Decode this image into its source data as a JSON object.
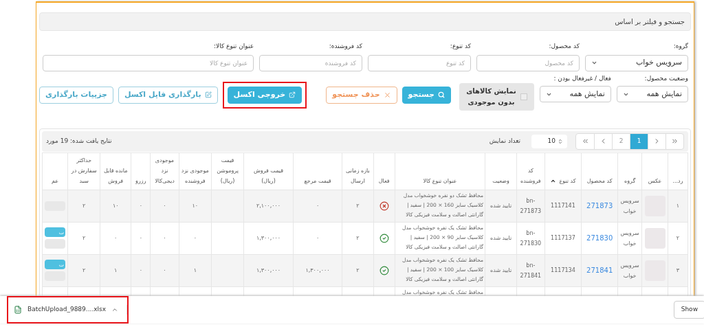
{
  "filter_panel": {
    "title": "جستجو و فیلتر بر اساس",
    "fields": [
      {
        "label": "گروه:",
        "kind": "select",
        "value": "سرویس خواب"
      },
      {
        "label": "کد محصول:",
        "kind": "input",
        "placeholder": "کد محصول"
      },
      {
        "label": "کد تنوع:",
        "kind": "input",
        "placeholder": "کد تنوع"
      },
      {
        "label": "کد فروشنده:",
        "kind": "input",
        "placeholder": "کد فروشنده"
      },
      {
        "label": "عنوان تنوع کالا:",
        "kind": "input",
        "placeholder": "عنوان تنوع کالا"
      }
    ],
    "filters": [
      {
        "label": "وضعیت محصول:",
        "kind": "select",
        "value": "نمایش همه"
      },
      {
        "label": "فعال / غیرفعال بودن :",
        "kind": "select",
        "value": "نمایش همه"
      }
    ],
    "checkbox": {
      "label": "نمایش کالاهای بدون موجودی",
      "checked": false
    },
    "buttons": [
      {
        "label": "جستجو",
        "kind": "search",
        "highlighted": false
      },
      {
        "label": "حذف جستجو",
        "kind": "clear",
        "highlighted": false
      },
      {
        "label": "خروجی اکسل",
        "kind": "export",
        "highlighted": true
      },
      {
        "label": "بارگذاری فایل اکسل",
        "kind": "upload",
        "highlighted": false
      },
      {
        "label": "جزییات بارگذاری",
        "kind": "details",
        "highlighted": false
      }
    ]
  },
  "table": {
    "pages": [
      {
        "label": "1",
        "selected": true
      },
      {
        "label": "2",
        "selected": false
      }
    ],
    "page_size": "10",
    "page_size_label": "تعداد نمایش",
    "results": "نتایج یافت شده: 19 مورد",
    "columns": [
      "رد...",
      "عکس",
      "گروه",
      "کد محصول",
      "کد تنوع",
      "کد فروشنده",
      "وضعیت",
      "عنوان تنوع کالا",
      "فعال",
      "بازه زمانی ارسال",
      "قیمت مرجع",
      "قیمت فروش (ریال)",
      "قیمت پروموشن (ریال)",
      "موجودی نزد فروشنده",
      "موجودی نزد دیجی‌کالا",
      "رزرو",
      "مانده قابل فروش",
      "حداکثر سفارش در سبد",
      "عم"
    ],
    "rows": [
      {
        "row": "۱",
        "photo": true,
        "group": "سرویس خواب",
        "product_code": "271873",
        "variant_code": "1117141",
        "seller_code": "bn-271873",
        "status": "تایید شده",
        "title": "محافظ تشک دو نفره خوشخواب مدل کلاسیک سایز 160 × 200 | سفید | گارانتی اصالت و سلامت فیزیکی کالا",
        "active": false,
        "send_period": "۲",
        "ref_price": "۰",
        "sale_price": "۲,۱۰۰,۰۰۰",
        "seller_stock": "۱۰",
        "dk_stock": "۰",
        "reserved": "۰",
        "remaining": "۱۰",
        "max_order": "۲",
        "actions": [
          {
            "kind": "secondary"
          }
        ]
      },
      {
        "row": "۲",
        "photo": true,
        "group": "سرویس خواب",
        "product_code": "271830",
        "variant_code": "1117137",
        "seller_code": "bn-271830",
        "status": "تایید شده",
        "title": "محافظ تشک یک نفره خوشخواب مدل کلاسیک سایز 90 × 200 | سفید | گارانتی اصالت و سلامت فیزیکی کالا",
        "active": true,
        "send_period": "۲",
        "ref_price": "۰",
        "sale_price": "۱,۳۰۰,۰۰۰",
        "seller_stock": "۰",
        "dk_stock": "۰",
        "reserved": "۰",
        "remaining": "۰",
        "max_order": "۲",
        "actions": [
          {
            "kind": "primary",
            "label": "ت"
          },
          {
            "kind": "secondary"
          }
        ]
      },
      {
        "row": "۳",
        "photo": true,
        "group": "سرویس خواب",
        "product_code": "271841",
        "variant_code": "1117134",
        "seller_code": "bn-271841",
        "status": "تایید شده",
        "title": "محافظ تشک یک نفره خوشخواب مدل کلاسیک سایز 100 × 200 | سفید | گارانتی اصالت و سلامت فیزیکی کالا",
        "active": true,
        "send_period": "۲",
        "ref_price": "۱,۳۰۰,۰۰۰",
        "sale_price": "۱,۳۰۰,۰۰۰",
        "seller_stock": "۱",
        "dk_stock": "۰",
        "reserved": "۰",
        "remaining": "۱",
        "max_order": "۲",
        "actions": [
          {
            "kind": "primary",
            "label": "ت"
          },
          {
            "kind": "secondary"
          }
        ]
      },
      {
        "row": "",
        "title": "محافظ تشک یک نفره خوشخواب مدل"
      }
    ]
  },
  "download_bar": {
    "file": "BatchUpload_9889....xlsx",
    "highlighted": true,
    "show_button": "Show"
  }
}
